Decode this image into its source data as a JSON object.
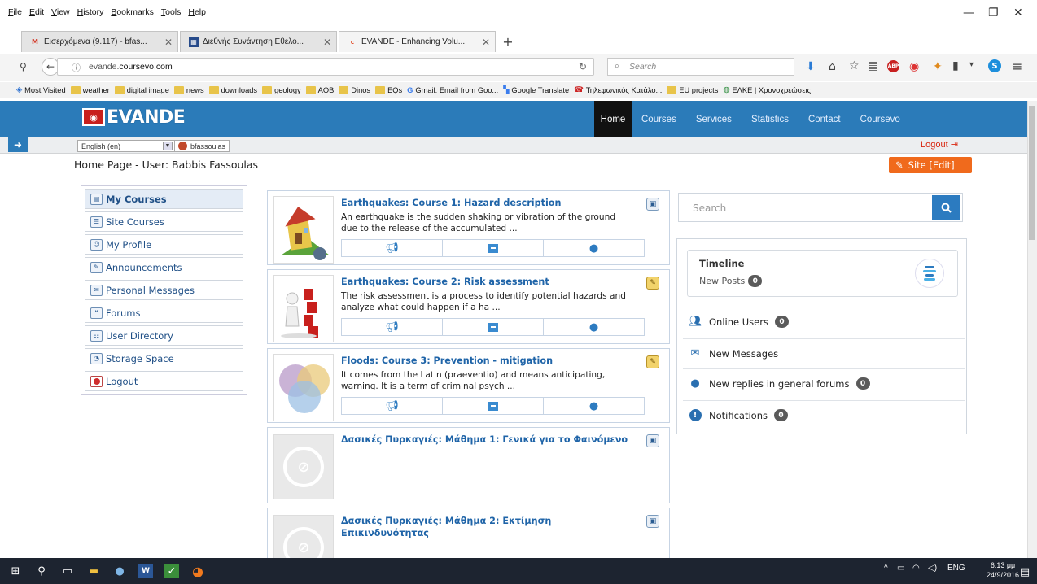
{
  "browser": {
    "menu": [
      "File",
      "Edit",
      "View",
      "History",
      "Bookmarks",
      "Tools",
      "Help"
    ],
    "tabs": [
      {
        "label": "Εισερχόμενα (9.117) - bfas...",
        "icon": "gmail-icon"
      },
      {
        "label": "Διεθνής Συνάντηση Εθελο...",
        "icon": "table-icon"
      },
      {
        "label": "EVANDE - Enhancing Volu...",
        "icon": "coursevo-icon",
        "active": true
      }
    ],
    "url_prefix": "evande.",
    "url_domain": "coursevo.com",
    "search_placeholder": "Search",
    "bookmarks": [
      "Most Visited",
      "weather",
      "digital image",
      "news",
      "downloads",
      "geology",
      "AOB",
      "Dinos",
      "EQs",
      "Gmail: Email from Goo...",
      "Google Translate",
      "Τηλεφωνικός Κατάλο...",
      "EU projects",
      "ΕΛΚΕ | Χρονοχρεώσεις"
    ]
  },
  "site": {
    "logo_text": "EVANDE",
    "nav": [
      "Home",
      "Courses",
      "Services",
      "Statistics",
      "Contact",
      "Coursevo"
    ],
    "language": "English (en)",
    "username": "bfassoulas",
    "logout": "Logout",
    "breadcrumb": "Home Page - User: Babbis Fassoulas",
    "site_edit": "Site [Edit]"
  },
  "sidebar": {
    "items": [
      {
        "label": "My Courses",
        "icon": "courses-icon"
      },
      {
        "label": "Site Courses",
        "icon": "site-courses-icon"
      },
      {
        "label": "My Profile",
        "icon": "profile-icon"
      },
      {
        "label": "Announcements",
        "icon": "announcements-icon"
      },
      {
        "label": "Personal Messages",
        "icon": "messages-icon"
      },
      {
        "label": "Forums",
        "icon": "forums-icon"
      },
      {
        "label": "User Directory",
        "icon": "directory-icon"
      },
      {
        "label": "Storage Space",
        "icon": "storage-icon"
      },
      {
        "label": "Logout",
        "icon": "logout-icon"
      }
    ]
  },
  "courses": [
    {
      "title": "Earthquakes: Course 1: Hazard description",
      "desc": "An earthquake is the sudden shaking or vibration of the ground due to the release of the accumulated ..."
    },
    {
      "title": "Earthquakes: Course 2: Risk assessment",
      "desc": "The risk assessment is a process to identify potential hazards and analyze what could happen if a ha ..."
    },
    {
      "title": "Floods: Course 3: Prevention - mitigation",
      "desc": "It comes from the Latin (praeventio) and means anticipating, warning. It is a term of criminal psych ..."
    },
    {
      "title": "Δασικές Πυρκαγιές: Μάθημα 1: Γενικά για το Φαινόμενο",
      "desc": ""
    },
    {
      "title": "Δασικές Πυρκαγιές: Μάθημα 2: Εκτίμηση Επικινδυνότητας",
      "desc": ""
    }
  ],
  "right": {
    "search_placeholder": "Search",
    "timeline_title": "Timeline",
    "timeline_sub": "New Posts",
    "timeline_count": "0",
    "rows": [
      {
        "label": "Online Users",
        "count": "0"
      },
      {
        "label": "New Messages",
        "count": ""
      },
      {
        "label": "New replies in general forums",
        "count": "0"
      },
      {
        "label": "Notifications",
        "count": "0"
      }
    ]
  },
  "taskbar": {
    "lang": "ENG",
    "time": "6:13 μμ",
    "date": "24/9/2016"
  },
  "colors": {
    "brand": "#2b7bb9",
    "accent": "#f06a1c",
    "link": "#1f64a8"
  }
}
